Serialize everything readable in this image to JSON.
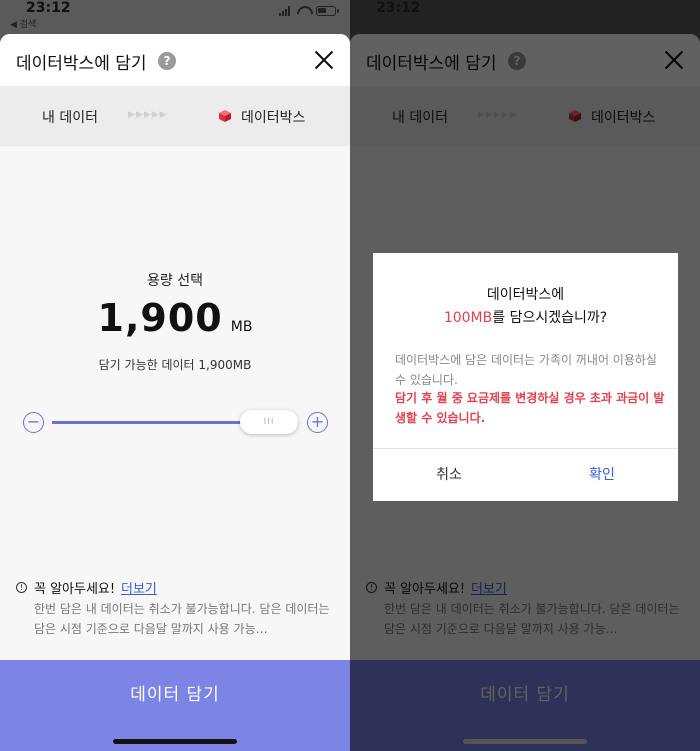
{
  "status": {
    "time": "23:12",
    "back": "◀ 검색"
  },
  "header": {
    "title": "데이터박스에 담기",
    "help": "?"
  },
  "flow": {
    "from": "내 데이터",
    "arrows": "▶▶▶▶▶",
    "to": "데이터박스"
  },
  "capacity": {
    "title": "용량 선택",
    "value": "1,900",
    "unit": "MB",
    "available": "담기 가능한 데이터 1,900MB"
  },
  "slider": {
    "min": 0,
    "max": 1900,
    "value": 1900,
    "minus": "−",
    "plus": "+",
    "thumb": "III"
  },
  "notice": {
    "title": "꼭 알아두세요!",
    "more": "더보기",
    "text": "한번 담은 내 데이터는 취소가 불가능합니다. 담은 데이터는 담은 시점 기준으로 다음달 말까지 사용 가능…"
  },
  "cta": {
    "label": "데이터 담기"
  },
  "dialog": {
    "title_line1": "데이터박스에",
    "amount": "100MB",
    "title_line2_rest": "를 담으시겠습니까?",
    "body": "데이터박스에 담은 데이터는 가족이 꺼내어 이용하실 수 있습니다.",
    "warning": "담기 후 월 중 요금제를 변경하실 경우 초과 과금이 발생할 수 있습니다.",
    "cancel": "취소",
    "confirm": "확인"
  },
  "colors": {
    "accent": "#7c84e6",
    "warning": "#e0434f",
    "link": "#3a5bd9"
  }
}
